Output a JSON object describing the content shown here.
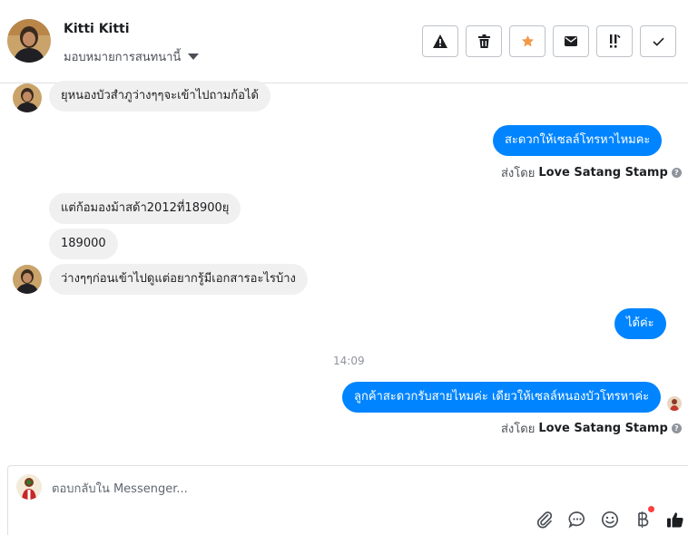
{
  "header": {
    "contact_name": "Kitti Kitti",
    "assign_label": "มอบหมายการสนทนานี้",
    "toolbar": [
      {
        "icon": "warning-icon",
        "name": "report-spam-button"
      },
      {
        "icon": "trash-icon",
        "name": "delete-button"
      },
      {
        "icon": "star-icon",
        "name": "star-button"
      },
      {
        "icon": "envelope-icon",
        "name": "mark-unread-button"
      },
      {
        "icon": "follow-up-icon",
        "name": "follow-up-button"
      },
      {
        "icon": "check-icon",
        "name": "mark-done-button"
      }
    ],
    "star_color": "#f2994a"
  },
  "messages": {
    "m1": "ยุหนองบัวสำภูว่างๆๆจะเข้าไปถามก้อได้",
    "m2": "สะดวกให้เซลล์โทรหาไหมคะ",
    "m2_sent_prefix": "ส่งโดย",
    "m2_sent_by": "Love Satang Stamp",
    "m3": "แต่ก้อมองม้าสด้า2012ที่18900ยุ",
    "m4": "189000",
    "m5": "ว่างๆๆก่อนเข้าไปดูแต่อยากรู้มีเอกสารอะไรบ้าง",
    "m6": "ได้ค่ะ",
    "time": "14:09",
    "m7": "ลูกค้าสะดวกรับสายไหมค่ะ เดียวให้เซลล์หนองบัวโทรหาค่ะ",
    "m7_sent_prefix": "ส่งโดย",
    "m7_sent_by": "Love Satang Stamp",
    "help_glyph": "?"
  },
  "composer": {
    "placeholder": "ตอบกลับใน Messenger...",
    "tools": [
      "attachment-icon",
      "saved-replies-icon",
      "emoji-icon",
      "payment-icon",
      "thumbs-up-icon"
    ]
  },
  "colors": {
    "outgoing_bubble": "#0084ff",
    "incoming_bubble": "#f1f0f0",
    "accent_icon": "#4b4f56"
  }
}
